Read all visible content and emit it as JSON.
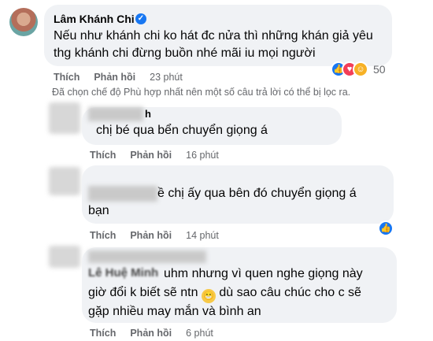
{
  "comment_main": {
    "author": "Lâm Khánh Chi",
    "line1": "Nếu như khánh chi ko hát đc nửa thì những khán giả yêu",
    "line2": "thg khánh chi đừng buồn nhé mãi iu mọi người",
    "like_label": "Thích",
    "reply_label": "Phản hồi",
    "time": "23 phút",
    "reaction_count": "50",
    "reaction_icons": [
      "like-icon",
      "love-icon",
      "haha-icon"
    ]
  },
  "notice": "Đã chọn chế độ Phù hợp nhất nên một số câu trả lời có thể bị lọc ra.",
  "reply1": {
    "author_visible": "h",
    "text": "chị bé qua bển chuyển giọng á",
    "like_label": "Thích",
    "reply_label": "Phản hồi",
    "time": "16 phút"
  },
  "reply2": {
    "line1": "ề chị ấy qua bên đó chuyển giọng á",
    "line2": "bạn",
    "like_label": "Thích",
    "reply_label": "Phản hồi",
    "time": "14 phút",
    "reaction_icon": "like-icon"
  },
  "reply3": {
    "author_visible": "Lê Huệ Minh",
    "line1": "uhm nhưng vì quen nghe giọng này",
    "line2a": "giờ đổi k biết sẽ ntn",
    "line2b": "dù sao câu chúc cho c sẽ",
    "line3": "gặp nhiều may mắn và bình an",
    "emoji": "grinning-emoji",
    "like_label": "Thích",
    "reply_label": "Phản hồi",
    "time": "6 phút"
  },
  "colors": {
    "bubble": "#f0f2f5",
    "meta": "#65676b",
    "like_blue": "#1877f2",
    "love_red": "#f33e58",
    "haha_yellow": "#f7b125"
  }
}
